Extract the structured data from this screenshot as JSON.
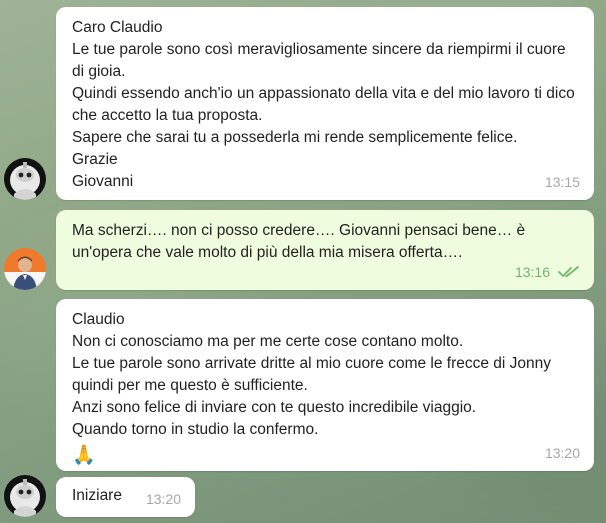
{
  "messages": [
    {
      "text": "Caro Claudio\nLe tue parole sono così meravigliosamente sincere da riempirmi il cuore di gioia.\nQuindi essendo anch'io un appassionato della vita e del mio lavoro ti dico che accetto la tua proposta.\nSapere che sarai tu a possederla mi rende semplicemente felice.\nGrazie\nGiovanni",
      "time": "13:15"
    },
    {
      "text": "Ma scherzi…. non ci posso credere…. Giovanni pensaci bene… è un'opera che vale molto di più della mia misera offerta….",
      "time": "13:16"
    },
    {
      "text": "Claudio\nNon ci conosciamo ma per me certe cose contano molto.\nLe tue parole sono arrivate dritte al mio cuore come le frecce di Jonny quindi per me questo è sufficiente.\nAnzi sono felice di inviare con te questo incredibile viaggio.\nQuando torno in studio la confermo.",
      "emoji": "🙏",
      "time": "13:20"
    },
    {
      "text": "Iniziare",
      "time": "13:20"
    }
  ],
  "icons": {
    "read_receipt": "double-check-icon",
    "avatar_contact": "robot-avatar",
    "avatar_self": "person-avatar"
  },
  "colors": {
    "incoming_bubble": "#ffffff",
    "outgoing_bubble": "#effdde",
    "outgoing_time": "#6fb76a",
    "incoming_time": "#a7a7a7"
  }
}
